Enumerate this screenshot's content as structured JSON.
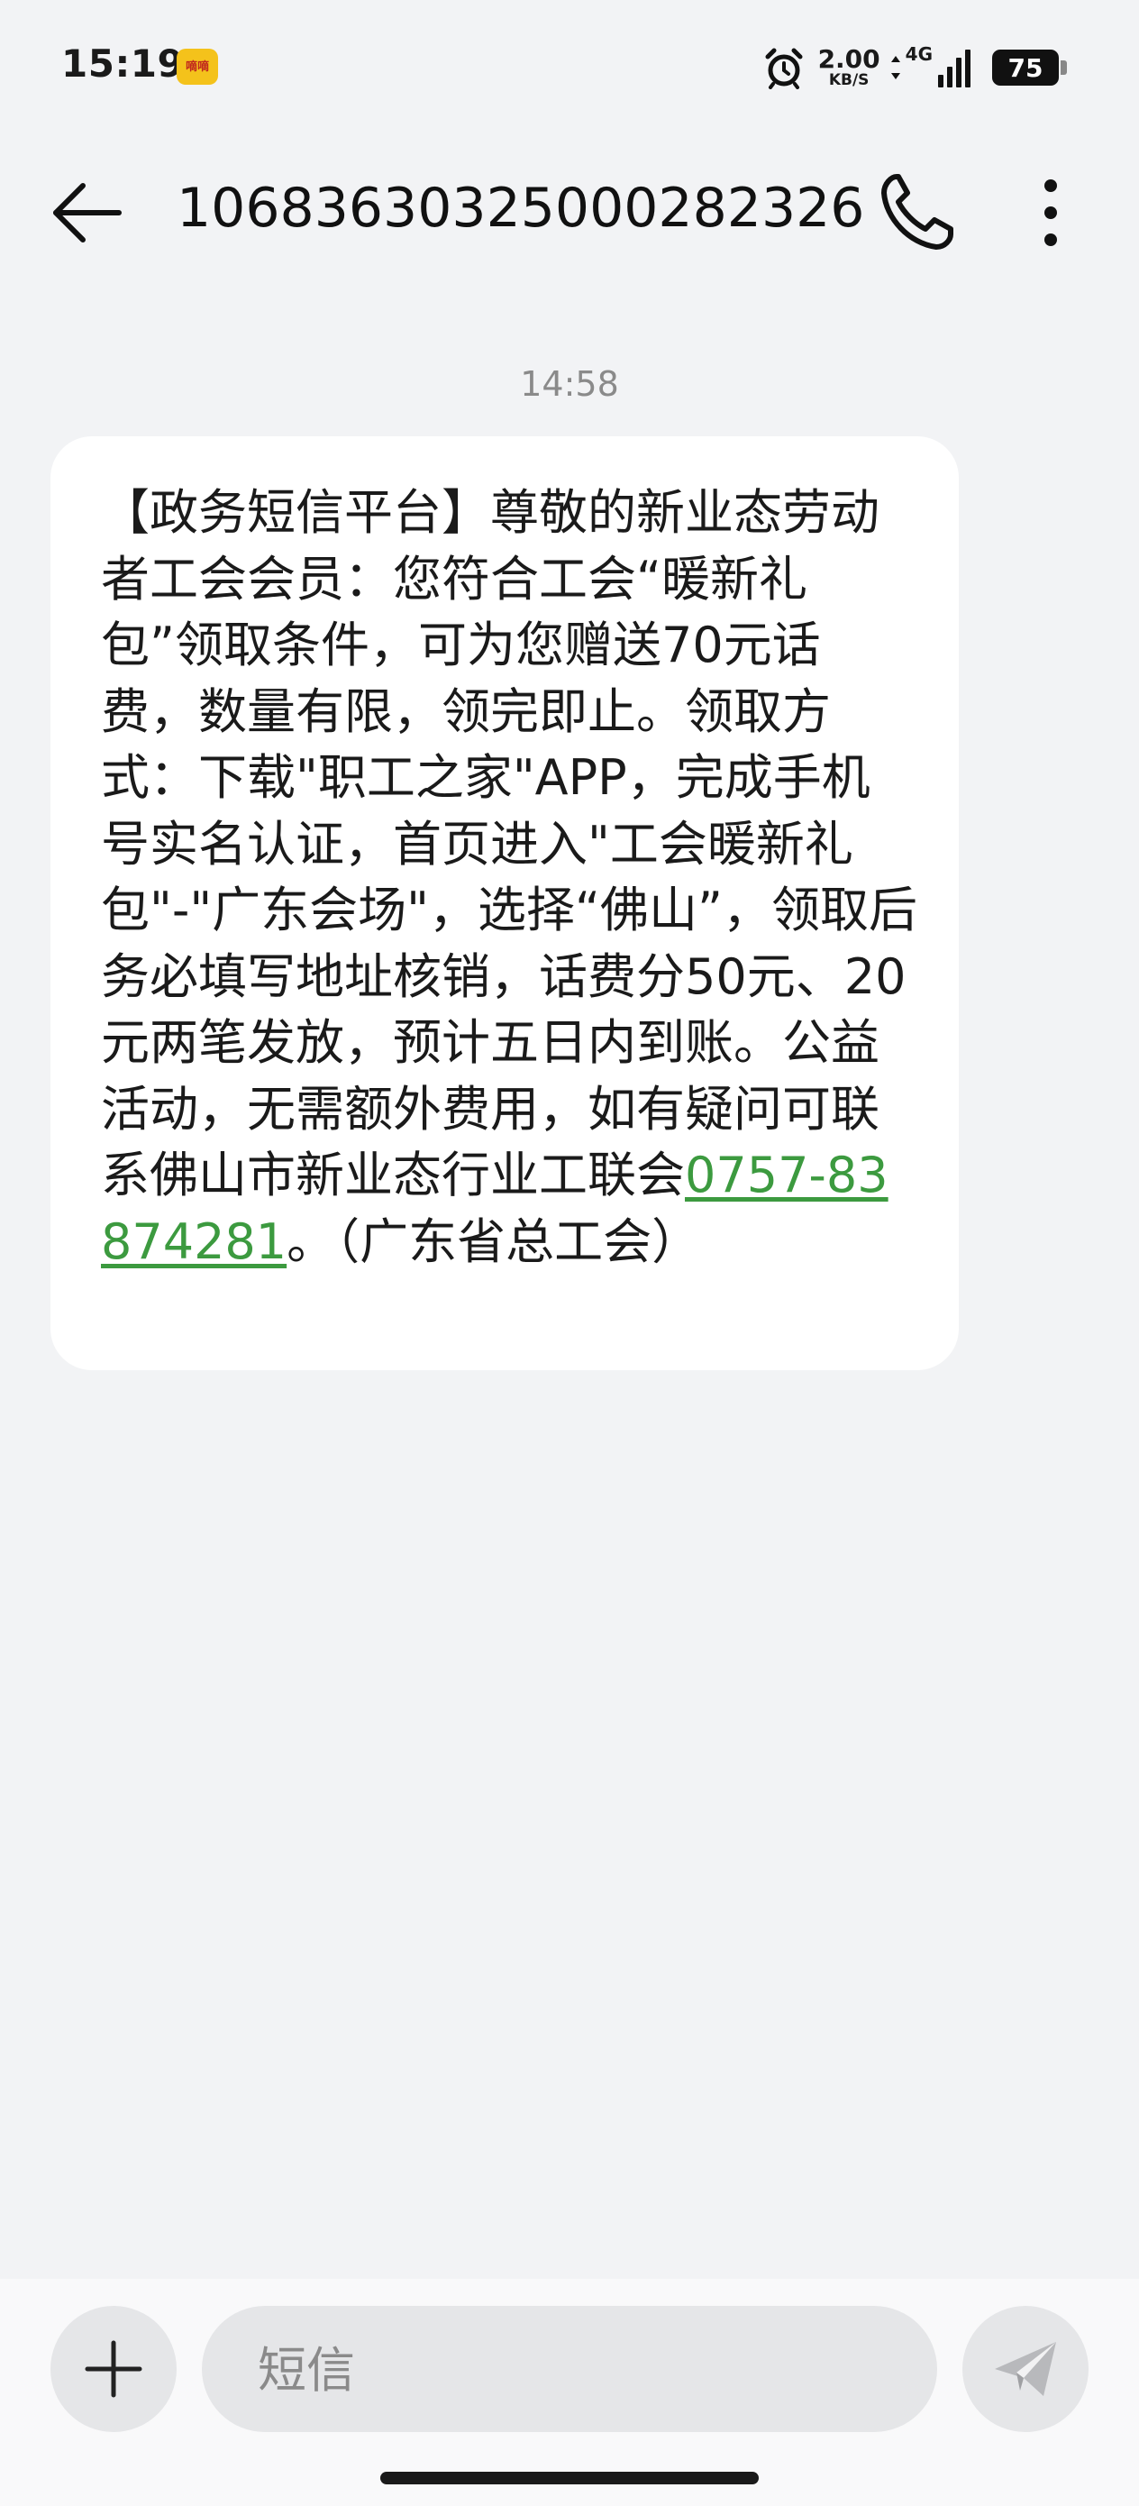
{
  "status_bar": {
    "time": "15:19",
    "notification_app_text": "嘀嘀",
    "net_speed_value": "2.00",
    "net_speed_unit": "KB/S",
    "network_type": "4G",
    "battery_level": "75",
    "icons": [
      "alarm-icon",
      "updown-arrows-icon",
      "signal-icon",
      "battery-icon"
    ]
  },
  "header": {
    "contact_number": "10683630325000282326",
    "icons": [
      "back-arrow-icon",
      "phone-icon",
      "more-vertical-icon"
    ]
  },
  "conversation": {
    "timestamp": "14:58",
    "message": {
      "text_before_link": "【政务短信平台】尊敬的新业态劳动者工会会员：您符合工会“暖新礼包”领取条件，可为您赠送70元话费，数量有限，领完即止。领取方式：下载\"职工之家\"APP，完成手机号实名认证，首页进入\"工会暖新礼包\"-\"广东会场\"，选择“佛山”，领取后务必填写地址核销，话费分50元、20元两笔发放，预计五日内到账。公益活动，无需额外费用，如有疑问可联系佛山市新业态行业工联会",
      "link_text": "0757-83874281",
      "text_after_link": "。（广东省总工会）"
    }
  },
  "composer": {
    "placeholder": "短信",
    "icons": [
      "plus-icon",
      "send-icon"
    ],
    "link_color": "#3c9a3f"
  }
}
